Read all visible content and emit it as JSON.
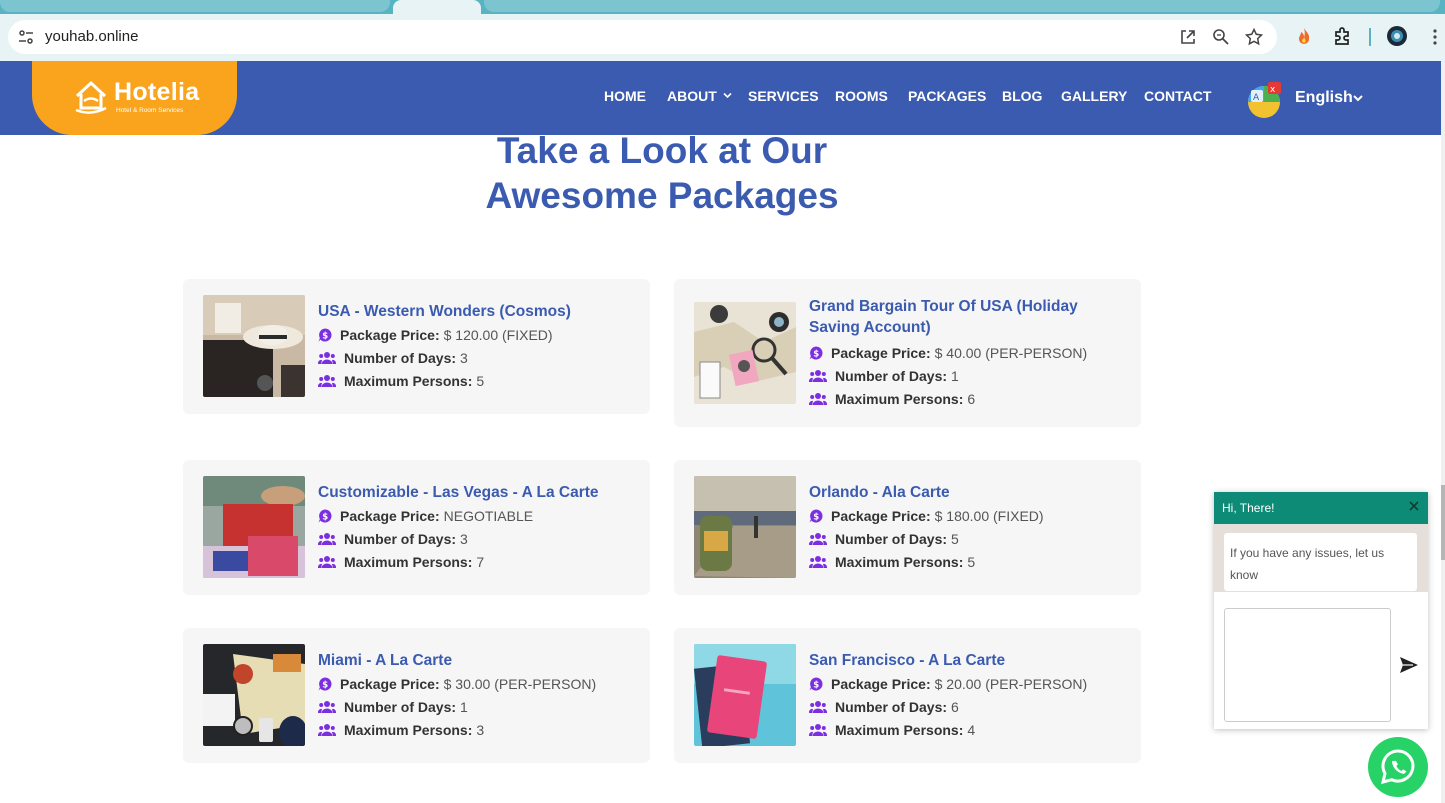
{
  "browser": {
    "url": "youhab.online"
  },
  "header": {
    "logo_name": "Hotelia",
    "logo_tagline": "Hotel & Room Services",
    "nav": [
      {
        "label": "HOME"
      },
      {
        "label": "ABOUT"
      },
      {
        "label": "SERVICES"
      },
      {
        "label": "ROOMS"
      },
      {
        "label": "PACKAGES"
      },
      {
        "label": "BLOG"
      },
      {
        "label": "GALLERY"
      },
      {
        "label": "CONTACT"
      }
    ],
    "language": "English"
  },
  "main": {
    "heading_line1": "Take a Look at Our",
    "heading_line2": "Awesome Packages",
    "labels": {
      "price": "Package Price:",
      "days": "Number of Days:",
      "persons": "Maximum Persons:"
    },
    "packages": [
      {
        "title": "USA - Western Wonders (Cosmos)",
        "price": "$ 120.00 (FIXED)",
        "days": "3",
        "persons": "5"
      },
      {
        "title": "Grand Bargain Tour Of USA (Holiday Saving Account)",
        "price": "$ 40.00 (PER-PERSON)",
        "days": "1",
        "persons": "6"
      },
      {
        "title": "Customizable - Las Vegas - A La Carte",
        "price": "NEGOTIABLE",
        "days": "3",
        "persons": "7"
      },
      {
        "title": "Orlando - Ala Carte",
        "price": "$ 180.00 (FIXED)",
        "days": "5",
        "persons": "5"
      },
      {
        "title": "Miami - A La Carte",
        "price": "$ 30.00 (PER-PERSON)",
        "days": "1",
        "persons": "3"
      },
      {
        "title": "San Francisco - A La Carte",
        "price": "$ 20.00 (PER-PERSON)",
        "days": "6",
        "persons": "4"
      }
    ]
  },
  "chat": {
    "greeting": "Hi, There!",
    "message": "If you have any issues, let us know",
    "input_value": ""
  },
  "colors": {
    "brand_blue": "#3b5bb0",
    "logo_orange": "#f9a41c",
    "icon_purple": "#7b2fe0",
    "chat_green": "#0e8b76",
    "whatsapp_green": "#27d366"
  }
}
